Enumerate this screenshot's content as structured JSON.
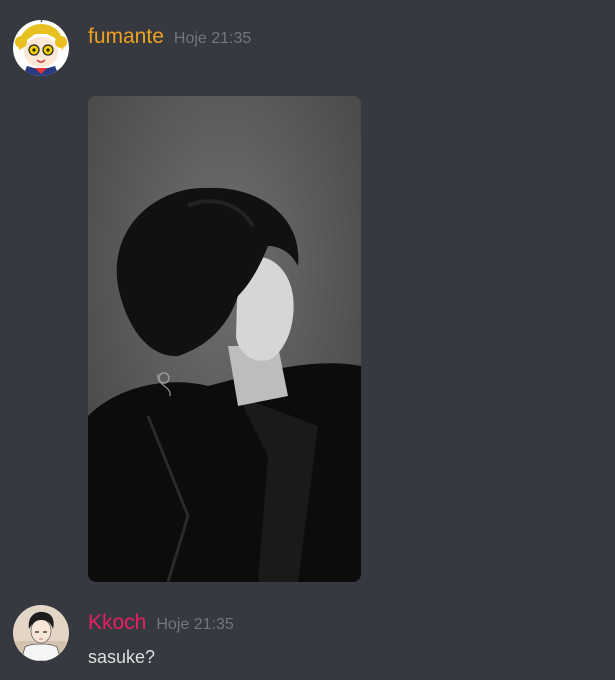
{
  "messages": [
    {
      "username": "fumante",
      "timestamp": "Hoje 21:35",
      "name_color": "#f0a020",
      "avatar_icon": "anime-girl-avatar-icon",
      "attachment": {
        "type": "image",
        "description_icon": "photo-attachment"
      }
    },
    {
      "username": "Kkoch",
      "timestamp": "Hoje 21:35",
      "name_color": "#e91e63",
      "avatar_icon": "manhwa-boy-avatar-icon",
      "text": "sasuke?"
    }
  ],
  "colors": {
    "background": "#36393f",
    "timestamp": "#72767d",
    "text": "#dcddde"
  }
}
